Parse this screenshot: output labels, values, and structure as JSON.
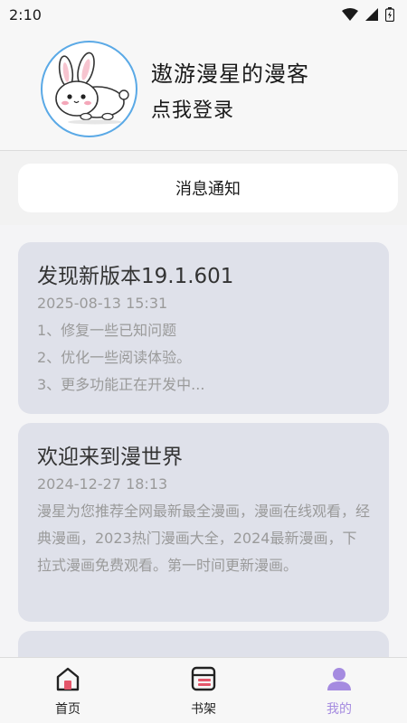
{
  "status_bar": {
    "time": "2:10"
  },
  "profile": {
    "username": "遨游漫星的漫客",
    "login_link": "点我登录"
  },
  "notice_button": "消息通知",
  "notices": [
    {
      "title": "发现新版本19.1.601",
      "date": "2025-08-13 15:31",
      "lines": [
        "1、修复一些已知问题",
        "2、优化一些阅读体验。",
        "3、更多功能正在开发中..."
      ]
    },
    {
      "title": "欢迎来到漫世界",
      "date": "2024-12-27 18:13",
      "body": "漫星为您推荐全网最新最全漫画，漫画在线观看，经典漫画，2023热门漫画大全，2024最新漫画，下拉式漫画免费观看。第一时间更新漫画。"
    }
  ],
  "bottom_nav": {
    "items": [
      {
        "label": "首页",
        "icon": "home-icon"
      },
      {
        "label": "书架",
        "icon": "bookshelf-icon"
      },
      {
        "label": "我的",
        "icon": "profile-icon",
        "active": true
      }
    ]
  },
  "colors": {
    "accent": "#a58be0",
    "card_bg": "#dfe1ea",
    "avatar_border": "#5aa9e6"
  }
}
